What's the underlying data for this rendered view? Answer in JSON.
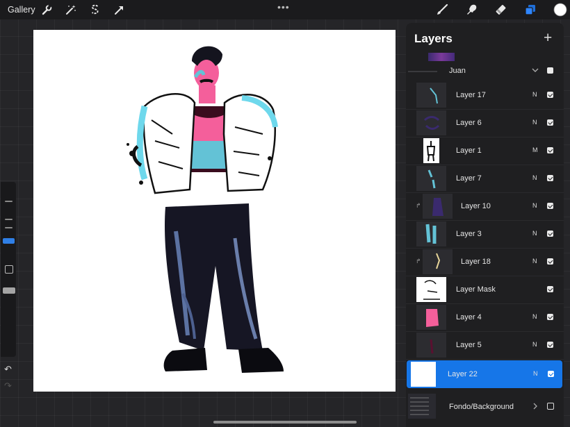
{
  "topbar": {
    "gallery": "Gallery",
    "more": "•••"
  },
  "tools_left": [
    "wrench-icon",
    "magic-wand-icon",
    "selection-icon",
    "transform-arrow-icon"
  ],
  "tools_right": [
    "brush-icon",
    "smudge-icon",
    "eraser-icon",
    "layers-icon",
    "color-swatch"
  ],
  "colors": {
    "accent": "#1676e8",
    "current_color": "#ffffff",
    "canvas": "#ffffff",
    "panel": "#1f1f21"
  },
  "sidebar": {
    "undo": "↶",
    "redo": "↷"
  },
  "layers_panel": {
    "title": "Layers",
    "add": "+",
    "group": {
      "name": "Juan",
      "expanded": true,
      "visible": true
    },
    "layers": [
      {
        "name": "Layer 17",
        "mode": "N",
        "visible": true,
        "clipped": false
      },
      {
        "name": "Layer 6",
        "mode": "N",
        "visible": true,
        "clipped": false
      },
      {
        "name": "Layer 1",
        "mode": "M",
        "visible": true,
        "clipped": false
      },
      {
        "name": "Layer 7",
        "mode": "N",
        "visible": true,
        "clipped": false
      },
      {
        "name": "Layer 10",
        "mode": "N",
        "visible": true,
        "clipped": true
      },
      {
        "name": "Layer 3",
        "mode": "N",
        "visible": true,
        "clipped": false
      },
      {
        "name": "Layer 18",
        "mode": "N",
        "visible": true,
        "clipped": true
      },
      {
        "name": "Layer Mask",
        "mode": "",
        "visible": true,
        "clipped": false
      },
      {
        "name": "Layer 4",
        "mode": "N",
        "visible": true,
        "clipped": false
      },
      {
        "name": "Layer 5",
        "mode": "N",
        "visible": true,
        "clipped": false
      },
      {
        "name": "Layer 22",
        "mode": "N",
        "visible": true,
        "clipped": false,
        "selected": true
      }
    ],
    "bottom_group": {
      "name": "Fondo/Background",
      "expanded": false,
      "visible": false
    }
  }
}
